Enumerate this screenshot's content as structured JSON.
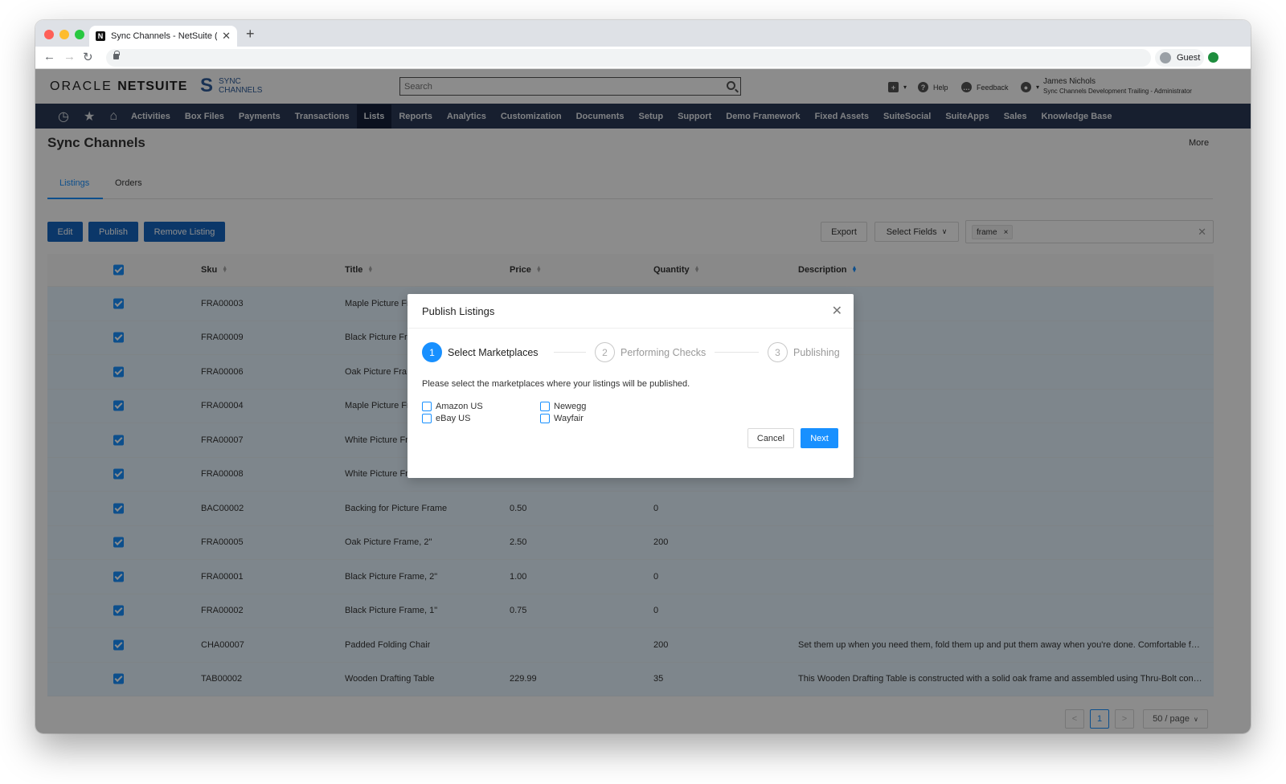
{
  "browser": {
    "tab_title": "Sync Channels - NetSuite (Sync Channels Development Trailing)",
    "favicon_letter": "N",
    "guest_label": "Guest"
  },
  "header": {
    "oracle_logo": "ORACLE",
    "netsuite_logo": "NETSUITE",
    "sync_logo_line1": "SYNC",
    "sync_logo_line2": "CHANNELS",
    "search_placeholder": "Search",
    "help_label": "Help",
    "feedback_label": "Feedback",
    "user_name": "James Nichols",
    "user_role": "Sync Channels Development Trailing - Administrator"
  },
  "navbar": {
    "items": [
      "Activities",
      "Box Files",
      "Payments",
      "Transactions",
      "Lists",
      "Reports",
      "Analytics",
      "Customization",
      "Documents",
      "Setup",
      "Support",
      "Demo Framework",
      "Fixed Assets",
      "SuiteSocial",
      "SuiteApps",
      "Sales",
      "Knowledge Base"
    ],
    "active": "Lists"
  },
  "page": {
    "title": "Sync Channels",
    "more": "More",
    "tabs": [
      "Listings",
      "Orders"
    ],
    "active_tab": "Listings"
  },
  "actions": {
    "edit": "Edit",
    "publish": "Publish",
    "remove": "Remove Listing",
    "export": "Export",
    "select_fields": "Select Fields",
    "filter_tag": "frame"
  },
  "table": {
    "columns": [
      "Sku",
      "Title",
      "Price",
      "Quantity",
      "Description"
    ],
    "rows": [
      {
        "sku": "FRA00003",
        "title": "Maple Picture Fr",
        "price": "",
        "qty": "",
        "desc": ""
      },
      {
        "sku": "FRA00009",
        "title": "Black Picture Fr",
        "price": "",
        "qty": "",
        "desc": ""
      },
      {
        "sku": "FRA00006",
        "title": "Oak Picture Fra",
        "price": "",
        "qty": "",
        "desc": ""
      },
      {
        "sku": "FRA00004",
        "title": "Maple Picture Fr",
        "price": "",
        "qty": "",
        "desc": ""
      },
      {
        "sku": "FRA00007",
        "title": "White Picture Fr",
        "price": "",
        "qty": "",
        "desc": ""
      },
      {
        "sku": "FRA00008",
        "title": "White Picture Fr",
        "price": "",
        "qty": "",
        "desc": ""
      },
      {
        "sku": "BAC00002",
        "title": "Backing for Picture Frame",
        "price": "0.50",
        "qty": "0",
        "desc": ""
      },
      {
        "sku": "FRA00005",
        "title": "Oak Picture Frame, 2\"",
        "price": "2.50",
        "qty": "200",
        "desc": ""
      },
      {
        "sku": "FRA00001",
        "title": "Black Picture Frame, 2\"",
        "price": "1.00",
        "qty": "0",
        "desc": ""
      },
      {
        "sku": "FRA00002",
        "title": "Black Picture Frame, 1\"",
        "price": "0.75",
        "qty": "0",
        "desc": ""
      },
      {
        "sku": "CHA00007",
        "title": "Padded Folding Chair",
        "price": "",
        "qty": "200",
        "desc": "Set them up when you need them, fold them up and put them away when you're done. Comfortable foa..."
      },
      {
        "sku": "TAB00002",
        "title": "Wooden Drafting Table",
        "price": "229.99",
        "qty": "35",
        "desc": "This Wooden Drafting Table is constructed with a solid oak frame and assembled using Thru-Bolt const..."
      }
    ]
  },
  "pagination": {
    "prev": "<",
    "current": "1",
    "next": ">",
    "page_size": "50 / page"
  },
  "modal": {
    "title": "Publish Listings",
    "steps": [
      {
        "num": "1",
        "label": "Select Marketplaces"
      },
      {
        "num": "2",
        "label": "Performing Checks"
      },
      {
        "num": "3",
        "label": "Publishing"
      }
    ],
    "description": "Please select the marketplaces where your listings will be published.",
    "marketplaces": [
      "Amazon US",
      "eBay US",
      "Newegg",
      "Wayfair"
    ],
    "cancel": "Cancel",
    "next": "Next"
  },
  "colors": {
    "accent": "#1890ff",
    "navbar": "#2a3a56",
    "action_button": "#1565c0"
  }
}
